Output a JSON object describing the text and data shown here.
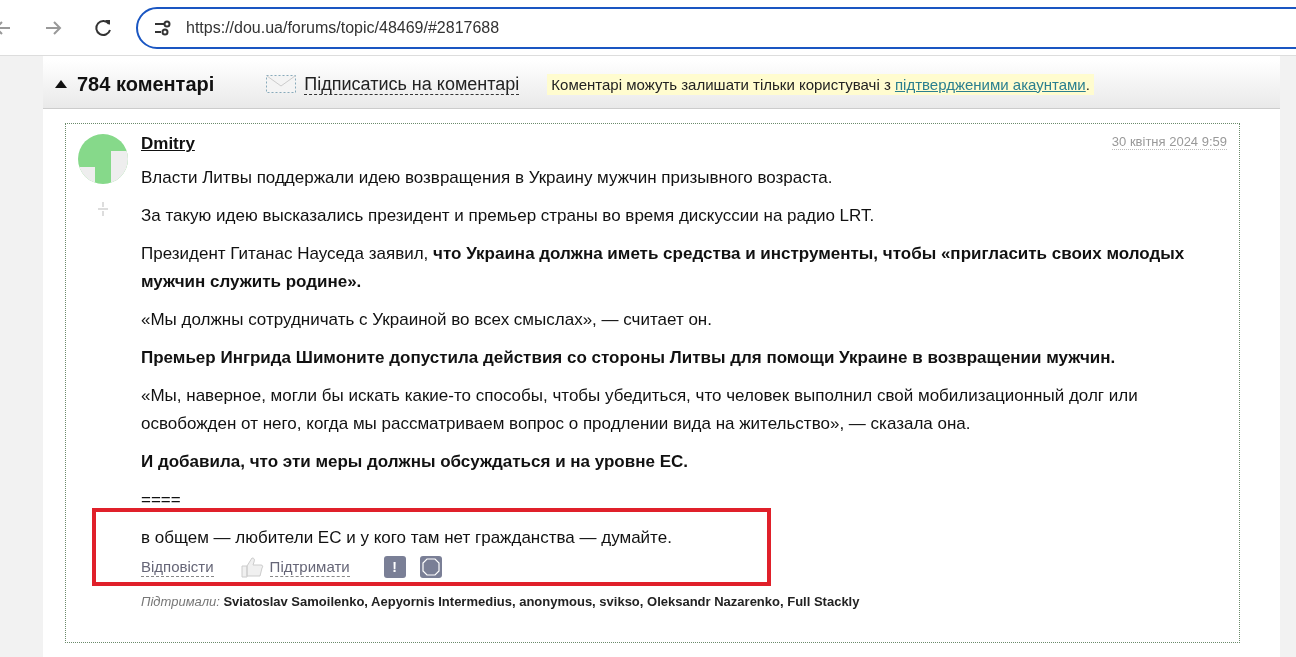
{
  "browser": {
    "url": "https://dou.ua/forums/topic/48469/#2817688"
  },
  "comments_header": {
    "count": "784 коментарі",
    "subscribe": "Підписатись на коментарі",
    "notice": "Коментарі можуть залишати тільки користувачі з ",
    "notice_link": "підтвердженими акаунтами",
    "notice_end": "."
  },
  "comment": {
    "author": "Dmitry",
    "date": "30 квітня 2024 9:59",
    "paragraphs": [
      {
        "text": "Власти Литвы поддержали идею возвращения в Украину мужчин призывного возраста.",
        "bold": false
      },
      {
        "text": "За такую идею высказались президент и премьер страны во время дискуссии на радио LRT.",
        "bold": false
      },
      {
        "text": "Президент Гитанас Науседа заявил, **что Украина должна иметь средства и инструменты, чтобы «пригласить своих молодых мужчин служить родине».**",
        "bold": false
      },
      {
        "text": "«Мы должны сотрудничать с Украиной во всех смыслах», — считает он.",
        "bold": false
      },
      {
        "text": "Премьер Ингрида Шимоните допустила действия со стороны Литвы для помощи Украине в возвращении мужчин.",
        "bold": true
      },
      {
        "text": "«Мы, наверное, могли бы искать какие-то способы, чтобы убедиться, что человек выполнил свой мобилизационный долг или освобожден от него, когда мы рассматриваем вопрос о продлении вида на жительство», — сказала она.",
        "bold": false
      },
      {
        "text": "И добавила, что эти меры должны обсуждаться и на уровне ЕС.",
        "bold": true
      },
      {
        "text": "====",
        "bold": false
      },
      {
        "text": "в общем — любители ЕС и у кого там нет гражданства — думайте.",
        "bold": false
      }
    ],
    "reply": "Відповісти",
    "support": "Підтримати",
    "report": "!",
    "supporters_label": "Підтримали:",
    "supporters": "Sviatoslav Samoilenko, Aepyornis Intermedius, anonymous, svikso, Oleksandr Nazarenko, Full Stackly"
  }
}
